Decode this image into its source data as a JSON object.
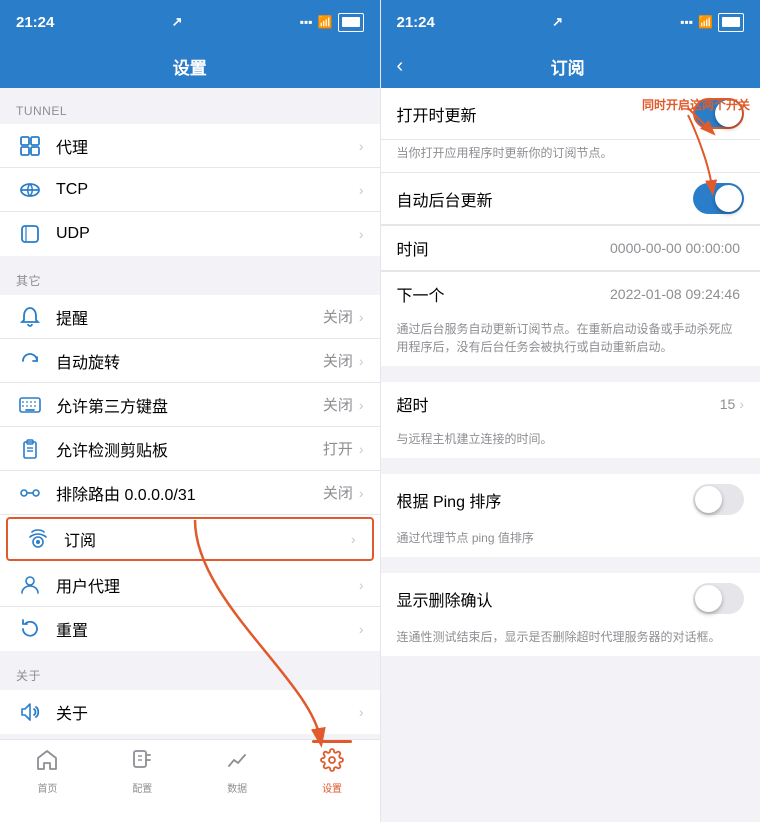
{
  "left": {
    "status_bar": {
      "time": "21:24",
      "signal_icon": "signal",
      "wifi_icon": "wifi",
      "battery_icon": "battery"
    },
    "nav_title": "设置",
    "sections": [
      {
        "label": "TUNNEL",
        "items": [
          {
            "id": "proxy",
            "icon": "layers",
            "text": "代理",
            "value": "",
            "has_chevron": true
          },
          {
            "id": "tcp",
            "icon": "tcp",
            "text": "TCP",
            "value": "",
            "has_chevron": true
          },
          {
            "id": "udp",
            "icon": "udp",
            "text": "UDP",
            "value": "",
            "has_chevron": true
          }
        ]
      },
      {
        "label": "其它",
        "items": [
          {
            "id": "remind",
            "icon": "bell",
            "text": "提醒",
            "value": "关闭",
            "has_chevron": true
          },
          {
            "id": "autorotate",
            "icon": "rotate",
            "text": "自动旋转",
            "value": "关闭",
            "has_chevron": true
          },
          {
            "id": "keyboard",
            "icon": "keyboard",
            "text": "允许第三方键盘",
            "value": "关闭",
            "has_chevron": true
          },
          {
            "id": "clipboard",
            "icon": "clipboard",
            "text": "允许检测剪贴板",
            "value": "打开",
            "has_chevron": true
          },
          {
            "id": "route",
            "icon": "route",
            "text": "排除路由 0.0.0.0/31",
            "value": "关闭",
            "has_chevron": true
          },
          {
            "id": "subscription",
            "icon": "subscription",
            "text": "订阅",
            "value": "",
            "has_chevron": true,
            "highlighted": true
          },
          {
            "id": "userproxy",
            "icon": "userproxy",
            "text": "用户代理",
            "value": "",
            "has_chevron": true
          },
          {
            "id": "reset",
            "icon": "reset",
            "text": "重置",
            "value": "",
            "has_chevron": true
          }
        ]
      },
      {
        "label": "关于",
        "items": [
          {
            "id": "about",
            "icon": "about",
            "text": "关于",
            "value": "",
            "has_chevron": true
          }
        ]
      }
    ],
    "tab_bar": {
      "items": [
        {
          "id": "home",
          "icon": "🏠",
          "label": "首页",
          "active": false
        },
        {
          "id": "config",
          "icon": "📁",
          "label": "配置",
          "active": false
        },
        {
          "id": "data",
          "icon": "📊",
          "label": "数据",
          "active": false
        },
        {
          "id": "settings",
          "icon": "⚙️",
          "label": "设置",
          "active": true
        }
      ]
    }
  },
  "right": {
    "status_bar": {
      "time": "21:24"
    },
    "nav_title": "订阅",
    "back_label": "‹",
    "items": [
      {
        "id": "open-update",
        "label": "打开时更新",
        "type": "toggle",
        "value": true,
        "highlighted": true,
        "sub_text": "当你打开应用程序时更新你的订阅节点。"
      },
      {
        "id": "auto-bg-update",
        "label": "自动后台更新",
        "type": "toggle",
        "value": true,
        "highlighted": false
      },
      {
        "id": "time",
        "label": "时间",
        "type": "value",
        "value": "0000-00-00 00:00:00"
      },
      {
        "id": "next",
        "label": "下一个",
        "type": "value",
        "value": "2022-01-08 09:24:46"
      },
      {
        "id": "bg-sub-text",
        "type": "subtext",
        "text": "通过后台服务自动更新订阅节点。在重新启动设备或手动杀死应用程序后，没有后台任务会被执行或自动重新启动。"
      },
      {
        "id": "timeout",
        "label": "超时",
        "type": "value-chevron",
        "value": "15"
      },
      {
        "id": "timeout-sub",
        "type": "subtext",
        "text": "与远程主机建立连接的时间。"
      },
      {
        "id": "ping-sort",
        "label": "根据 Ping 排序",
        "type": "toggle",
        "value": false
      },
      {
        "id": "ping-sub",
        "type": "subtext",
        "text": "通过代理节点 ping 值排序"
      },
      {
        "id": "delete-confirm",
        "label": "显示删除确认",
        "type": "toggle",
        "value": false
      },
      {
        "id": "delete-sub",
        "type": "subtext",
        "text": "连通性测试结束后，显示是否删除超时代理服务器的对话框。"
      }
    ],
    "annotation": "同时开启这两个开关"
  }
}
